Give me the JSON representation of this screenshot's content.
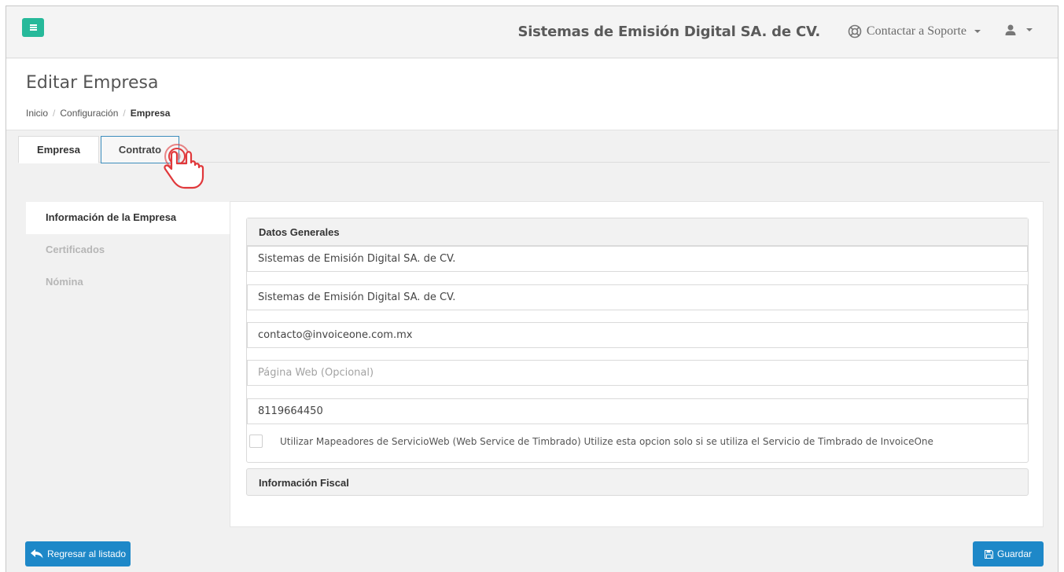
{
  "header": {
    "company_name": "Sistemas de Emisión Digital SA. de CV.",
    "support_label": "Contactar a Soporte"
  },
  "page": {
    "title": "Editar Empresa",
    "breadcrumb": [
      "Inicio",
      "Configuración",
      "Empresa"
    ]
  },
  "tabs": [
    "Empresa",
    "Contrato"
  ],
  "side_tabs": [
    "Información de la Empresa",
    "Certificados",
    "Nómina"
  ],
  "datos_generales": {
    "heading": "Datos Generales",
    "razon_social": "Sistemas de Emisión Digital SA. de CV.",
    "nombre_comercial": "Sistemas de Emisión Digital SA. de CV.",
    "email": "contacto@invoiceone.com.mx",
    "web_placeholder": "Página Web (Opcional)",
    "telefono": "8119664450",
    "checkbox_label": "Utilizar Mapeadores de ServicioWeb (Web Service de Timbrado) Utilize esta opcion solo si se utiliza el Servicio de Timbrado de InvoiceOne"
  },
  "informacion_fiscal": {
    "heading": "Información Fiscal"
  },
  "buttons": {
    "back": "Regresar al listado",
    "save": "Guardar"
  },
  "colors": {
    "menu_green": "#26b99a",
    "primary_blue": "#1e88c8",
    "pointer_red": "#e0383b"
  }
}
